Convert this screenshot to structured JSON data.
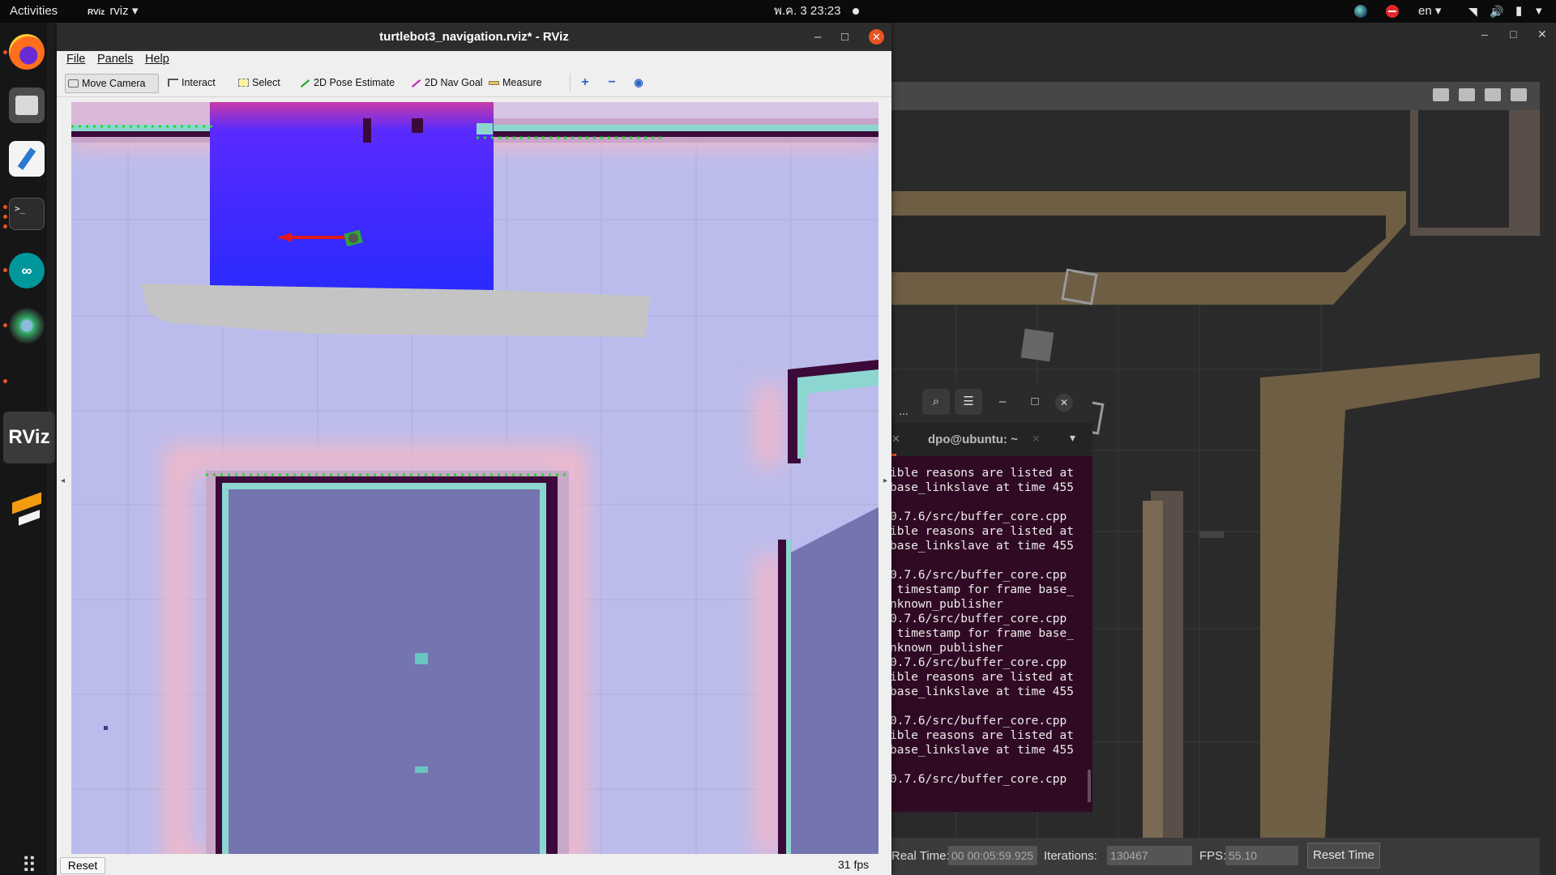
{
  "topbar": {
    "activities": "Activities",
    "app_menu": "rviz",
    "app_menu_icon": "RViz",
    "clock": "พ.ค. 3  23:23",
    "language": "en"
  },
  "dock": {
    "items": [
      "firefox",
      "files",
      "text-editor",
      "terminal",
      "arduino",
      "gazebo",
      "rviz",
      "sublime-text",
      "show-applications"
    ],
    "rviz_label": "RViz",
    "terminal_prompt": ">_",
    "arduino_glyph": "∞"
  },
  "rviz": {
    "title": "turtlebot3_navigation.rviz* - RViz",
    "menus": {
      "file": "File",
      "panels": "Panels",
      "help": "Help"
    },
    "tools": {
      "move_camera": "Move Camera",
      "interact": "Interact",
      "select": "Select",
      "pose_estimate": "2D Pose Estimate",
      "nav_goal": "2D Nav Goal",
      "measure": "Measure"
    },
    "reset_label": "Reset",
    "fps": "31 fps",
    "colors": {
      "costmap_high": "#2a2aff",
      "robot_arrow": "#e11a1a",
      "obstacle": "#3c0a3a",
      "free": "#bcbcec"
    }
  },
  "terminal": {
    "tab_title": "dpo@ubuntu: ~",
    "lines": [
      "ible reasons are listed at",
      "base_linkslave at time 455",
      "",
      "0.7.6/src/buffer_core.cpp",
      "ible reasons are listed at",
      "base_linkslave at time 455",
      "",
      "0.7.6/src/buffer_core.cpp",
      " timestamp for frame base_",
      "nknown_publisher",
      "0.7.6/src/buffer_core.cpp",
      " timestamp for frame base_",
      "nknown_publisher",
      "0.7.6/src/buffer_core.cpp",
      "ible reasons are listed at",
      "base_linkslave at time 455",
      "",
      "0.7.6/src/buffer_core.cpp",
      "ible reasons are listed at",
      "base_linkslave at time 455",
      "",
      "0.7.6/src/buffer_core.cpp"
    ]
  },
  "gazebo": {
    "real_time_label": "Real Time:",
    "real_time": "00 00:05:59.925",
    "iterations_label": "Iterations:",
    "iterations": "130467",
    "fps_label": "FPS:",
    "fps": "55.10",
    "reset_time": "Reset Time"
  }
}
